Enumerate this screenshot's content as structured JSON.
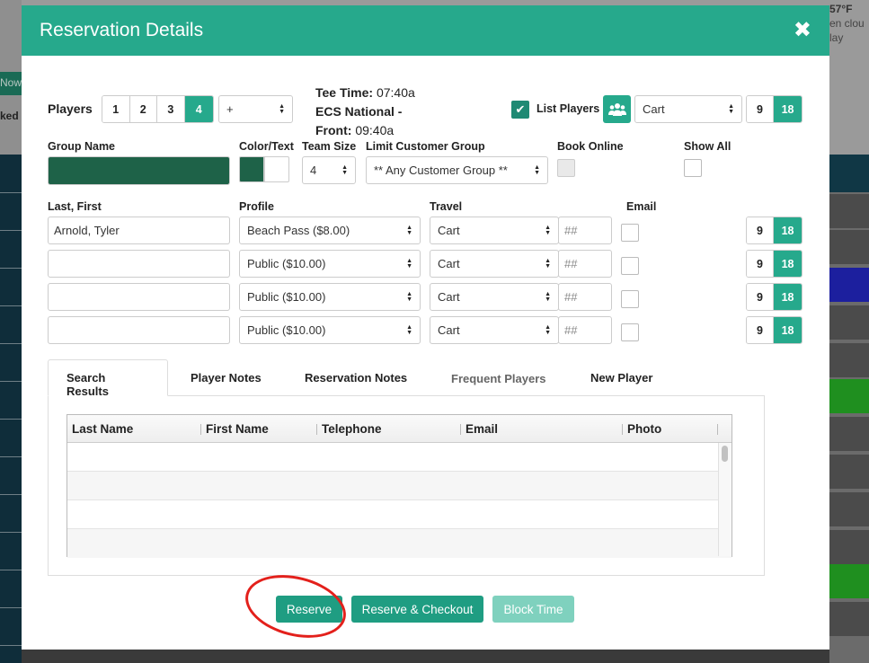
{
  "background": {
    "now_label": "Now",
    "ked_label": "ked",
    "weather": {
      "temp": "57°F",
      "desc": "en clou",
      "day": "lay"
    }
  },
  "modal": {
    "title": "Reservation Details",
    "close_symbol": "✖"
  },
  "players": {
    "label": "Players",
    "options": [
      "1",
      "2",
      "3",
      "4"
    ],
    "selected": "4",
    "extra_select": "+"
  },
  "tee_time": {
    "label": "Tee Time:",
    "time": "07:40a",
    "course": "ECS National -",
    "front_label": "Front:",
    "front_time": "09:40a"
  },
  "list_players": {
    "label": "List Players",
    "checked": true
  },
  "travel_default": "Cart",
  "holes": {
    "nine": "9",
    "eighteen": "18",
    "selected": "18"
  },
  "group": {
    "group_name_label": "Group Name",
    "color_text_label": "Color/Text",
    "team_size_label": "Team Size",
    "team_size_value": "4",
    "limit_label": "Limit Customer Group",
    "limit_value": "** Any Customer Group **",
    "book_online_label": "Book Online",
    "show_all_label": "Show All",
    "group_color": "#1e6248"
  },
  "player_rows": {
    "headers": {
      "name": "Last, First",
      "profile": "Profile",
      "travel": "Travel",
      "email": "Email"
    },
    "rows": [
      {
        "name": "Arnold, Tyler",
        "profile": "Beach Pass ($8.00)",
        "travel": "Cart",
        "hash": "##"
      },
      {
        "name": "",
        "profile": "Public ($10.00)",
        "travel": "Cart",
        "hash": "##"
      },
      {
        "name": "",
        "profile": "Public ($10.00)",
        "travel": "Cart",
        "hash": "##"
      },
      {
        "name": "",
        "profile": "Public ($10.00)",
        "travel": "Cart",
        "hash": "##"
      }
    ]
  },
  "tabs": [
    "Search Results",
    "Player Notes",
    "Reservation Notes",
    "Frequent Players",
    "New Player"
  ],
  "results_table": {
    "columns": [
      "Last Name",
      "First Name",
      "Telephone",
      "Email",
      "Photo"
    ]
  },
  "actions": {
    "reserve": "Reserve",
    "reserve_checkout": "Reserve & Checkout",
    "block_time": "Block Time"
  }
}
